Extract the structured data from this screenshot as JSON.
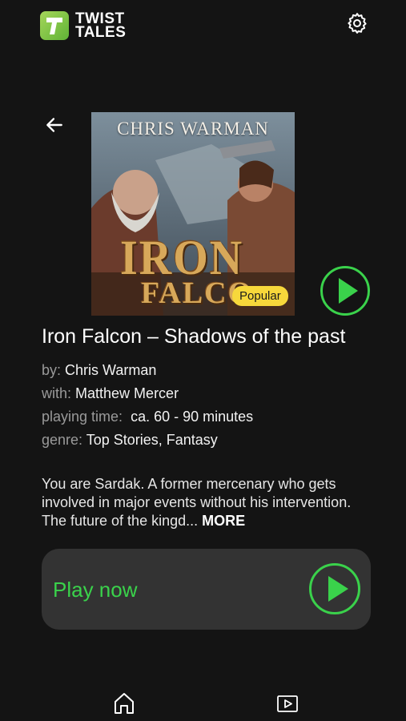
{
  "header": {
    "logo_letter": "T",
    "logo_line1": "TWIST",
    "logo_line2": "TALES",
    "settings_icon": "gear-icon",
    "back_icon": "arrow-left-icon"
  },
  "cover": {
    "author": "CHRIS WARMAN",
    "title_line1": "IRON",
    "title_line2": "FALCO",
    "badge": "Popular"
  },
  "book": {
    "title": "Iron Falcon – Shadows of the past",
    "by_label": "by:",
    "by_value": "Chris Warman",
    "with_label": "with:",
    "with_value": "Matthew Mercer",
    "time_label": "playing time:",
    "time_value": "ca. 60 - 90 minutes",
    "genre_label": "genre:",
    "genre_value": "Top Stories, Fantasy",
    "description": "You are Sardak. A former mercenary who gets involved in major events without his intervention. The future of the kingd...",
    "more_label": "MORE"
  },
  "play_card": {
    "label": "Play now"
  },
  "bottom_nav": {
    "home_icon": "home-icon",
    "video_icon": "video-icon"
  },
  "colors": {
    "background": "#141414",
    "accent_green": "#3ad24b",
    "badge_yellow": "#f7d83b",
    "card": "#333333"
  }
}
